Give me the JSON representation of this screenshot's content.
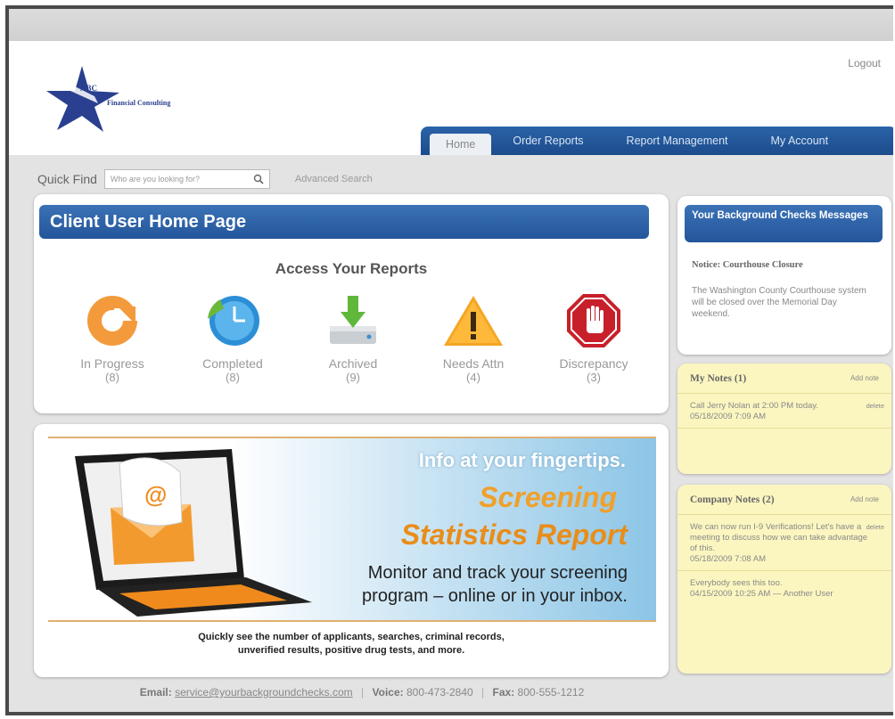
{
  "header": {
    "logo_badge": "ABC",
    "logo_text": "Financial Consulting",
    "logout_label": "Logout",
    "tabs": [
      {
        "label": "Home"
      },
      {
        "label": "Order Reports"
      },
      {
        "label": "Report Management"
      },
      {
        "label": "My Account"
      }
    ]
  },
  "quick_find": {
    "label": "Quick Find",
    "placeholder": "Who are you looking for?",
    "advanced_label": "Advanced Search"
  },
  "main": {
    "title": "Client User Home Page",
    "access_title": "Access Your Reports",
    "reports": [
      {
        "label": "In Progress",
        "count": "(8)",
        "icon": "refresh-icon"
      },
      {
        "label": "Completed",
        "count": "(8)",
        "icon": "clock-icon"
      },
      {
        "label": "Archived",
        "count": "(9)",
        "icon": "download-drive-icon"
      },
      {
        "label": "Needs Attn",
        "count": "(4)",
        "icon": "warning-icon"
      },
      {
        "label": "Discrepancy",
        "count": "(3)",
        "icon": "stop-hand-icon"
      }
    ]
  },
  "promo": {
    "tagline": "Info at your fingertips.",
    "title_line1": "Screening",
    "title_line2": "Statistics Report",
    "body_line1": "Monitor and track your screening",
    "body_line2": "program – online or in your inbox.",
    "caption_line1": "Quickly see the number of applicants, searches, criminal records,",
    "caption_line2": "unverified results, positive drug tests, and more."
  },
  "messages": {
    "title": "Your Background Checks Messages",
    "notice": "Notice: Courthouse Closure",
    "body": "The Washington County Courthouse system will be closed over the Memorial Day weekend."
  },
  "my_notes": {
    "title": "My Notes (1)",
    "add_label": "Add note",
    "notes": [
      {
        "text": "Call Jerry Nolan at 2:00 PM today.",
        "date": "05/18/2009 7:09 AM",
        "delete": "delete"
      }
    ]
  },
  "company_notes": {
    "title": "Company Notes (2)",
    "add_label": "Add note",
    "notes": [
      {
        "text": "We can now run I-9 Verifications! Let's have a meeting to discuss how we can take advantage of this.",
        "date": "05/18/2009 7:08 AM",
        "delete": "delete"
      },
      {
        "text": "Everybody sees this too.",
        "date": "04/15/2009 10:25 AM — Another User",
        "delete": ""
      }
    ]
  },
  "footer": {
    "email_label": "Email:",
    "email": "service@yourbackgroundchecks.com",
    "voice_label": "Voice:",
    "voice": "800-473-2840",
    "fax_label": "Fax:",
    "fax": "800-555-1212"
  },
  "colors": {
    "brand_blue": "#2b63a8",
    "notes_yellow": "#fbf6c0",
    "accent_orange": "#f0a02a"
  }
}
